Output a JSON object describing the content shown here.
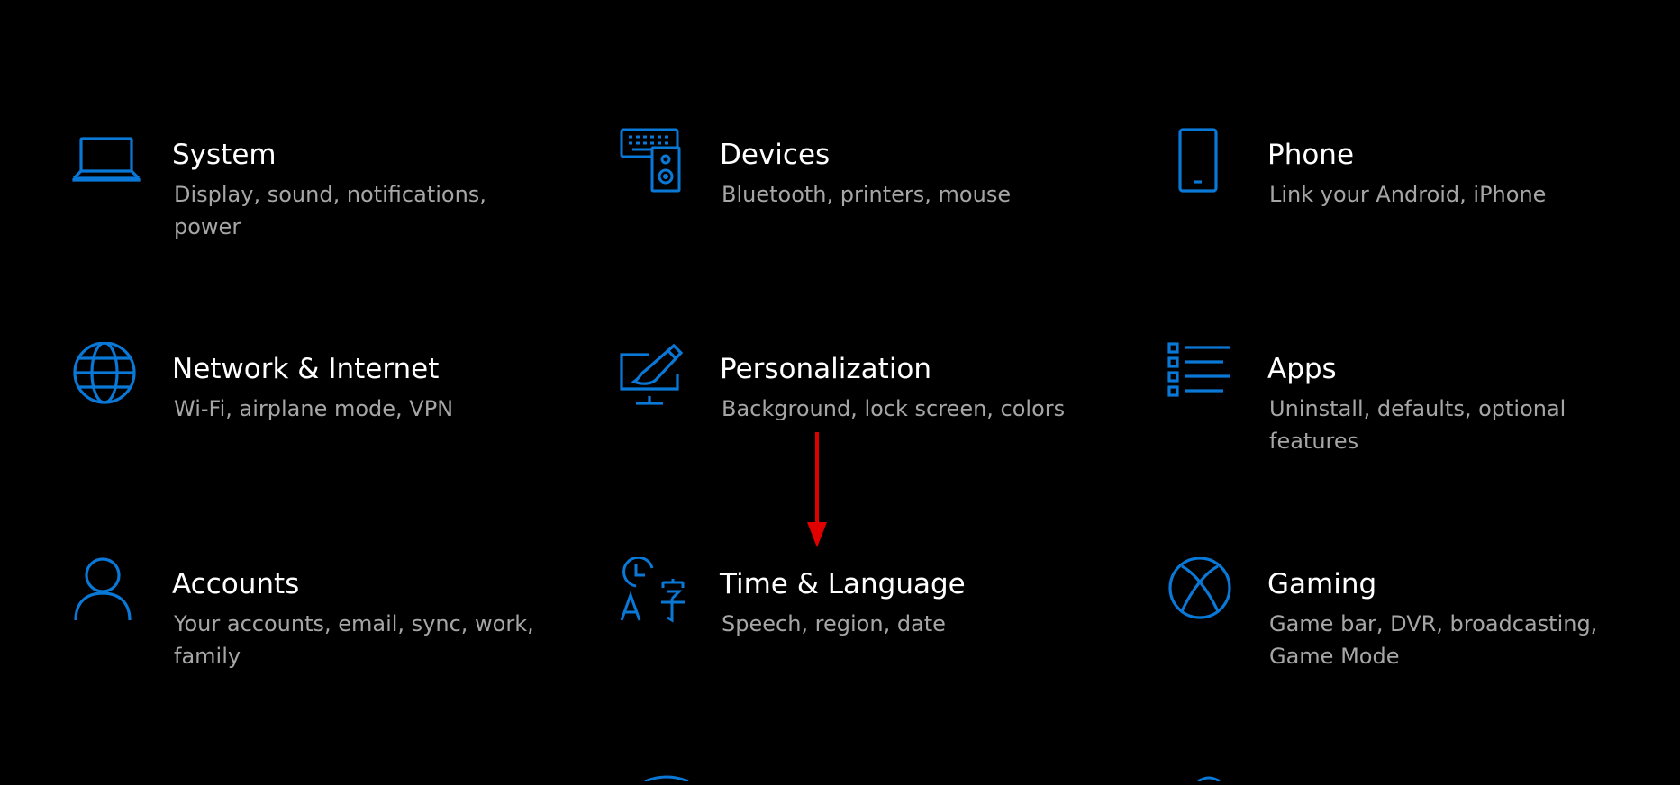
{
  "colors": {
    "background": "#000000",
    "accent": "#0a78d7",
    "title": "#ffffff",
    "description": "#a6a6a6",
    "annotation_arrow": "#e00000"
  },
  "tiles": [
    {
      "icon": "laptop-icon",
      "title": "System",
      "description": "Display, sound, notifications, power"
    },
    {
      "icon": "devices-icon",
      "title": "Devices",
      "description": "Bluetooth, printers, mouse"
    },
    {
      "icon": "phone-icon",
      "title": "Phone",
      "description": "Link your Android, iPhone"
    },
    {
      "icon": "globe-icon",
      "title": "Network & Internet",
      "description": "Wi-Fi, airplane mode, VPN"
    },
    {
      "icon": "personalization-icon",
      "title": "Personalization",
      "description": "Background, lock screen, colors"
    },
    {
      "icon": "apps-list-icon",
      "title": "Apps",
      "description": "Uninstall, defaults, optional features"
    },
    {
      "icon": "person-icon",
      "title": "Accounts",
      "description": "Your accounts, email, sync, work, family"
    },
    {
      "icon": "time-language-icon",
      "title": "Time & Language",
      "description": "Speech, region, date"
    },
    {
      "icon": "xbox-icon",
      "title": "Gaming",
      "description": "Game bar, DVR, broadcasting, Game Mode"
    }
  ],
  "annotation": {
    "icon": "red-down-arrow-icon"
  }
}
